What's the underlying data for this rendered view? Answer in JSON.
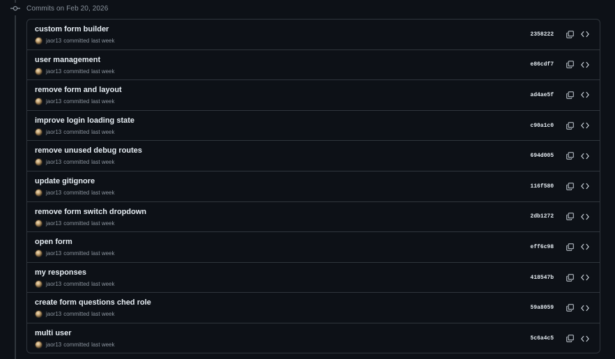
{
  "header": {
    "date_label": "Commits on Feb 20, 2026",
    "icon": "git-commit-icon"
  },
  "colors": {
    "background": "#0d1117",
    "border": "#30363d",
    "text_primary": "#e6edf3",
    "text_muted": "#8b949e"
  },
  "commits": [
    {
      "title": "custom form builder",
      "author": "jaor13",
      "action": "committed",
      "time": "last week",
      "sha": "2358222"
    },
    {
      "title": "user management",
      "author": "jaor13",
      "action": "committed",
      "time": "last week",
      "sha": "e86cdf7"
    },
    {
      "title": "remove form and layout",
      "author": "jaor13",
      "action": "committed",
      "time": "last week",
      "sha": "ad4ae5f"
    },
    {
      "title": "improve login loading state",
      "author": "jaor13",
      "action": "committed",
      "time": "last week",
      "sha": "c90a1c0"
    },
    {
      "title": "remove unused debug routes",
      "author": "jaor13",
      "action": "committed",
      "time": "last week",
      "sha": "694d005"
    },
    {
      "title": "update gitignore",
      "author": "jaor13",
      "action": "committed",
      "time": "last week",
      "sha": "116f580"
    },
    {
      "title": "remove form switch dropdown",
      "author": "jaor13",
      "action": "committed",
      "time": "last week",
      "sha": "2db1272"
    },
    {
      "title": "open form",
      "author": "jaor13",
      "action": "committed",
      "time": "last week",
      "sha": "eff6c98"
    },
    {
      "title": "my responses",
      "author": "jaor13",
      "action": "committed",
      "time": "last week",
      "sha": "418547b"
    },
    {
      "title": "create form questions ched role",
      "author": "jaor13",
      "action": "committed",
      "time": "last week",
      "sha": "59a8059"
    },
    {
      "title": "multi user",
      "author": "jaor13",
      "action": "committed",
      "time": "last week",
      "sha": "5c6a4c5"
    }
  ],
  "row_icons": [
    "copy-icon",
    "code-icon"
  ]
}
